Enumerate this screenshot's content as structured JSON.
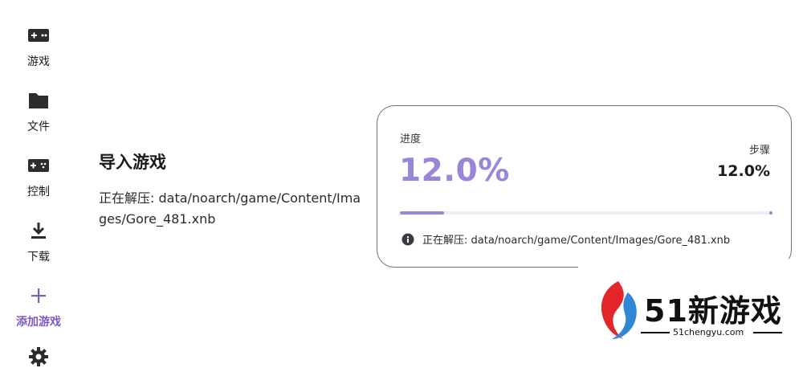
{
  "sidebar": {
    "items": [
      {
        "label": "游戏",
        "icon": "gamepad-icon"
      },
      {
        "label": "文件",
        "icon": "folder-icon"
      },
      {
        "label": "控制",
        "icon": "controller-icon"
      },
      {
        "label": "下载",
        "icon": "download-icon"
      },
      {
        "label": "添加游戏",
        "icon": "plus-icon",
        "active": true
      },
      {
        "label": "",
        "icon": "settings-icon"
      }
    ]
  },
  "main": {
    "title": "导入游戏",
    "status": "正在解压: data/noarch/game/Content/Images/Gore_481.xnb"
  },
  "progress_card": {
    "label": "进度",
    "percent_text": "12.0%",
    "step_label": "步骤",
    "step_value": "12.0%",
    "progress_fraction": 0.12,
    "info_text": "正在解压: data/noarch/game/Content/Images/Gore_481.xnb"
  },
  "watermark": {
    "title": "51新游戏",
    "url": "51chengyu.com"
  },
  "colors": {
    "accent": "#9a86d8",
    "accent_dark": "#7b5cc4",
    "border": "#6f6f76"
  }
}
